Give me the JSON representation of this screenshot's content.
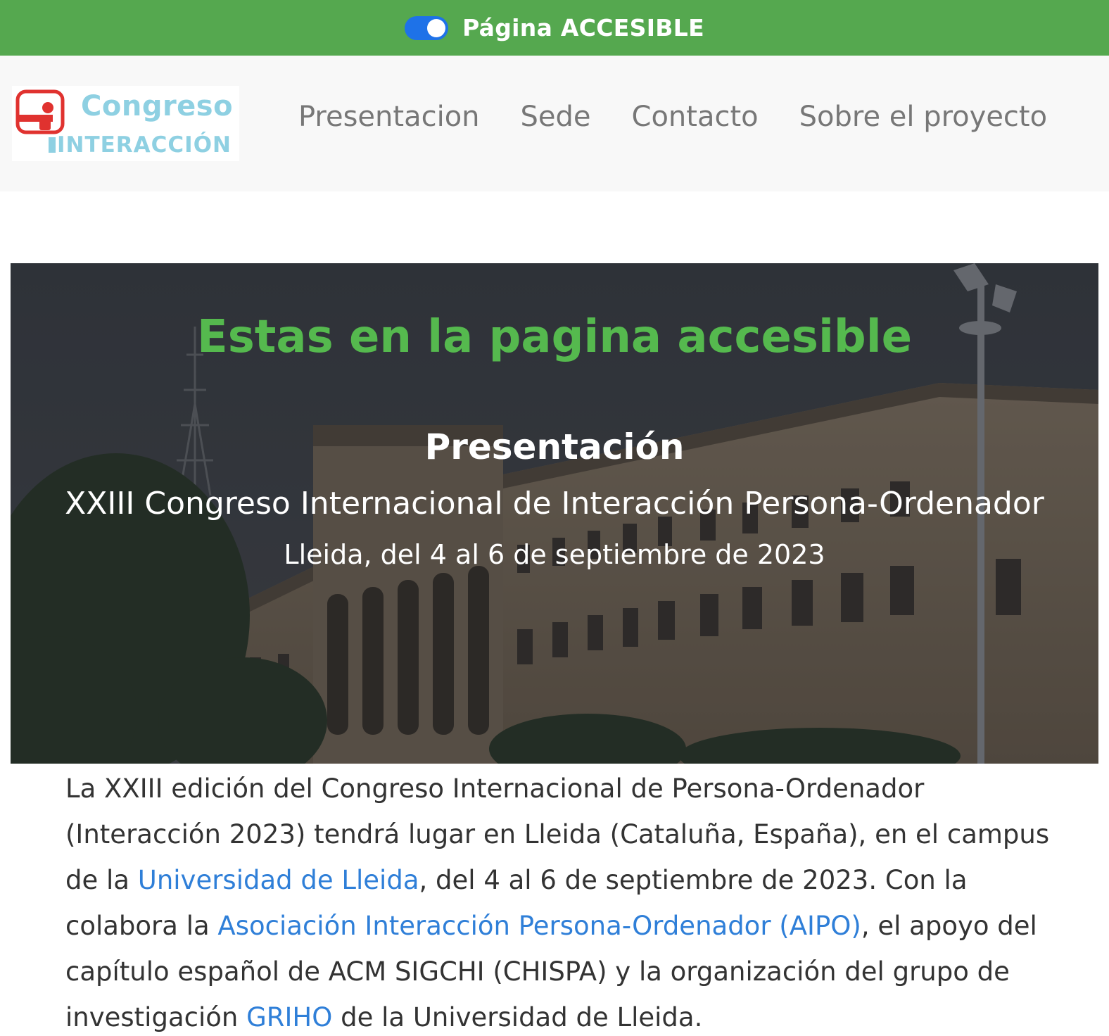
{
  "accessibility_bar": {
    "toggle_state": "on",
    "label": "Página ACCESIBLE",
    "bar_color": "#55a84f",
    "toggle_color": "#1e72e8"
  },
  "navbar": {
    "brand": {
      "word1": "Congreso",
      "word2": "INTERACCIÓN",
      "icon": "person-icon"
    },
    "links": [
      {
        "label": "Presentacion"
      },
      {
        "label": "Sede"
      },
      {
        "label": "Contacto"
      },
      {
        "label": "Sobre el proyecto"
      }
    ]
  },
  "hero": {
    "title": "Estas en la pagina accesible",
    "subtitle": "Presentación",
    "event": "XXIII Congreso Internacional de Interacción Persona-Ordenador",
    "date": "Lleida, del 4 al 6 de septiembre de 2023",
    "title_color": "#55b94e"
  },
  "intro": {
    "p1": "La XXIII edición del Congreso Internacional de Persona-Ordenador (Interacción 2023) tendrá lugar en Lleida (Cataluña, España), en el campus de la ",
    "link_udl": "Universidad de Lleida",
    "p2": ", del 4 al 6 de septiembre de 2023. Con la colabora la ",
    "link_aipo": "Asociación Interacción Persona-Ordenador (AIPO)",
    "p3": ", el apoyo del capítulo español de ACM SIGCHI (CHISPA) y la organización del grupo de investigación ",
    "link_griho": "GRIHO",
    "p4": " de la Universidad de Lleida.",
    "link_color": "#2f7fd8"
  }
}
